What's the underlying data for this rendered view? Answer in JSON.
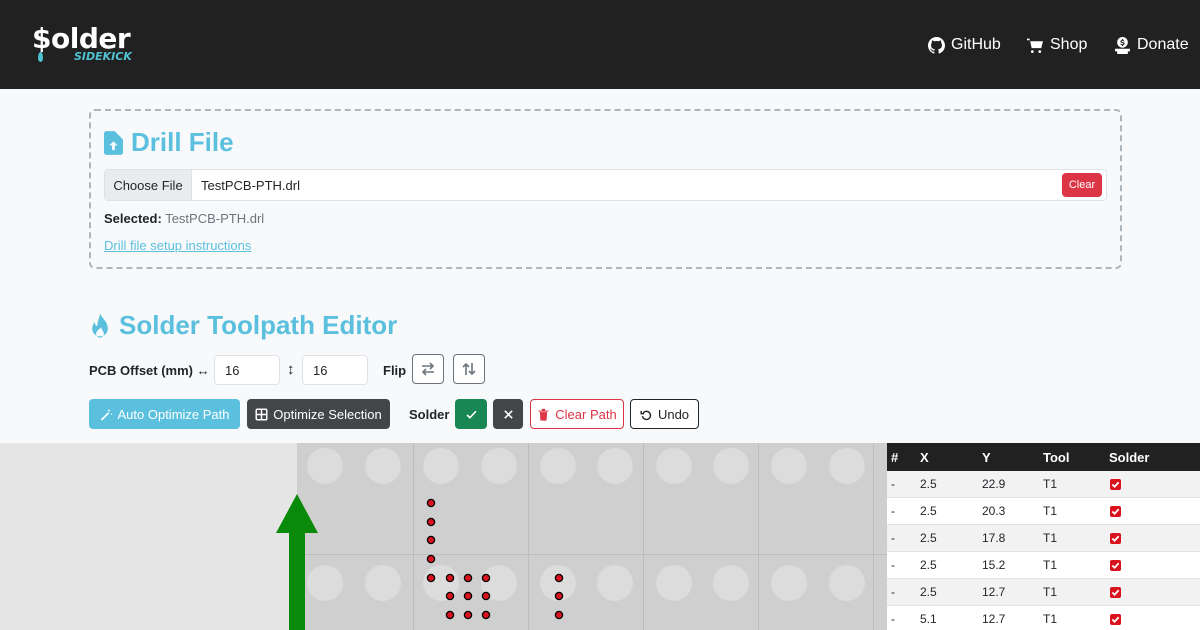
{
  "brand": {
    "logo_main": "$older",
    "logo_sub": "SIDEKICK",
    "accent": "#5bc0de",
    "nav_bg": "#212121"
  },
  "nav": {
    "items": [
      {
        "label": "GitHub",
        "icon": "github-icon"
      },
      {
        "label": "Shop",
        "icon": "cart-icon"
      },
      {
        "label": "Donate",
        "icon": "donate-icon"
      }
    ]
  },
  "drill": {
    "title": "Drill File",
    "title_icon": "file-upload-icon",
    "choose_label": "Choose File",
    "file_name": "TestPCB-PTH.drl",
    "clear_label": "Clear",
    "selected_label": "Selected:",
    "selected_value": "TestPCB-PTH.drl",
    "setup_link": "Drill file setup instructions"
  },
  "editor": {
    "title": "Solder Toolpath Editor",
    "title_icon": "fire-icon",
    "offset_label": "PCB Offset (mm)",
    "offset_x": "16",
    "offset_y": "16",
    "flip_label": "Flip",
    "auto_optimize_label": "Auto Optimize Path",
    "optimize_selection_label": "Optimize Selection",
    "solder_label": "Solder",
    "clear_path_label": "Clear Path",
    "undo_label": "Undo"
  },
  "table": {
    "headers": [
      "#",
      "X",
      "Y",
      "Tool",
      "Solder"
    ],
    "rows": [
      {
        "index": "-",
        "x": "2.5",
        "y": "22.9",
        "tool": "T1",
        "solder": true
      },
      {
        "index": "-",
        "x": "2.5",
        "y": "20.3",
        "tool": "T1",
        "solder": true
      },
      {
        "index": "-",
        "x": "2.5",
        "y": "17.8",
        "tool": "T1",
        "solder": true
      },
      {
        "index": "-",
        "x": "2.5",
        "y": "15.2",
        "tool": "T1",
        "solder": true
      },
      {
        "index": "-",
        "x": "2.5",
        "y": "12.7",
        "tool": "T1",
        "solder": true
      },
      {
        "index": "-",
        "x": "5.1",
        "y": "12.7",
        "tool": "T1",
        "solder": true
      }
    ]
  },
  "colors": {
    "arrow": "#0a8a0a",
    "pad": "#d8131f",
    "solder_on": "#198754",
    "danger": "#dc3545"
  }
}
